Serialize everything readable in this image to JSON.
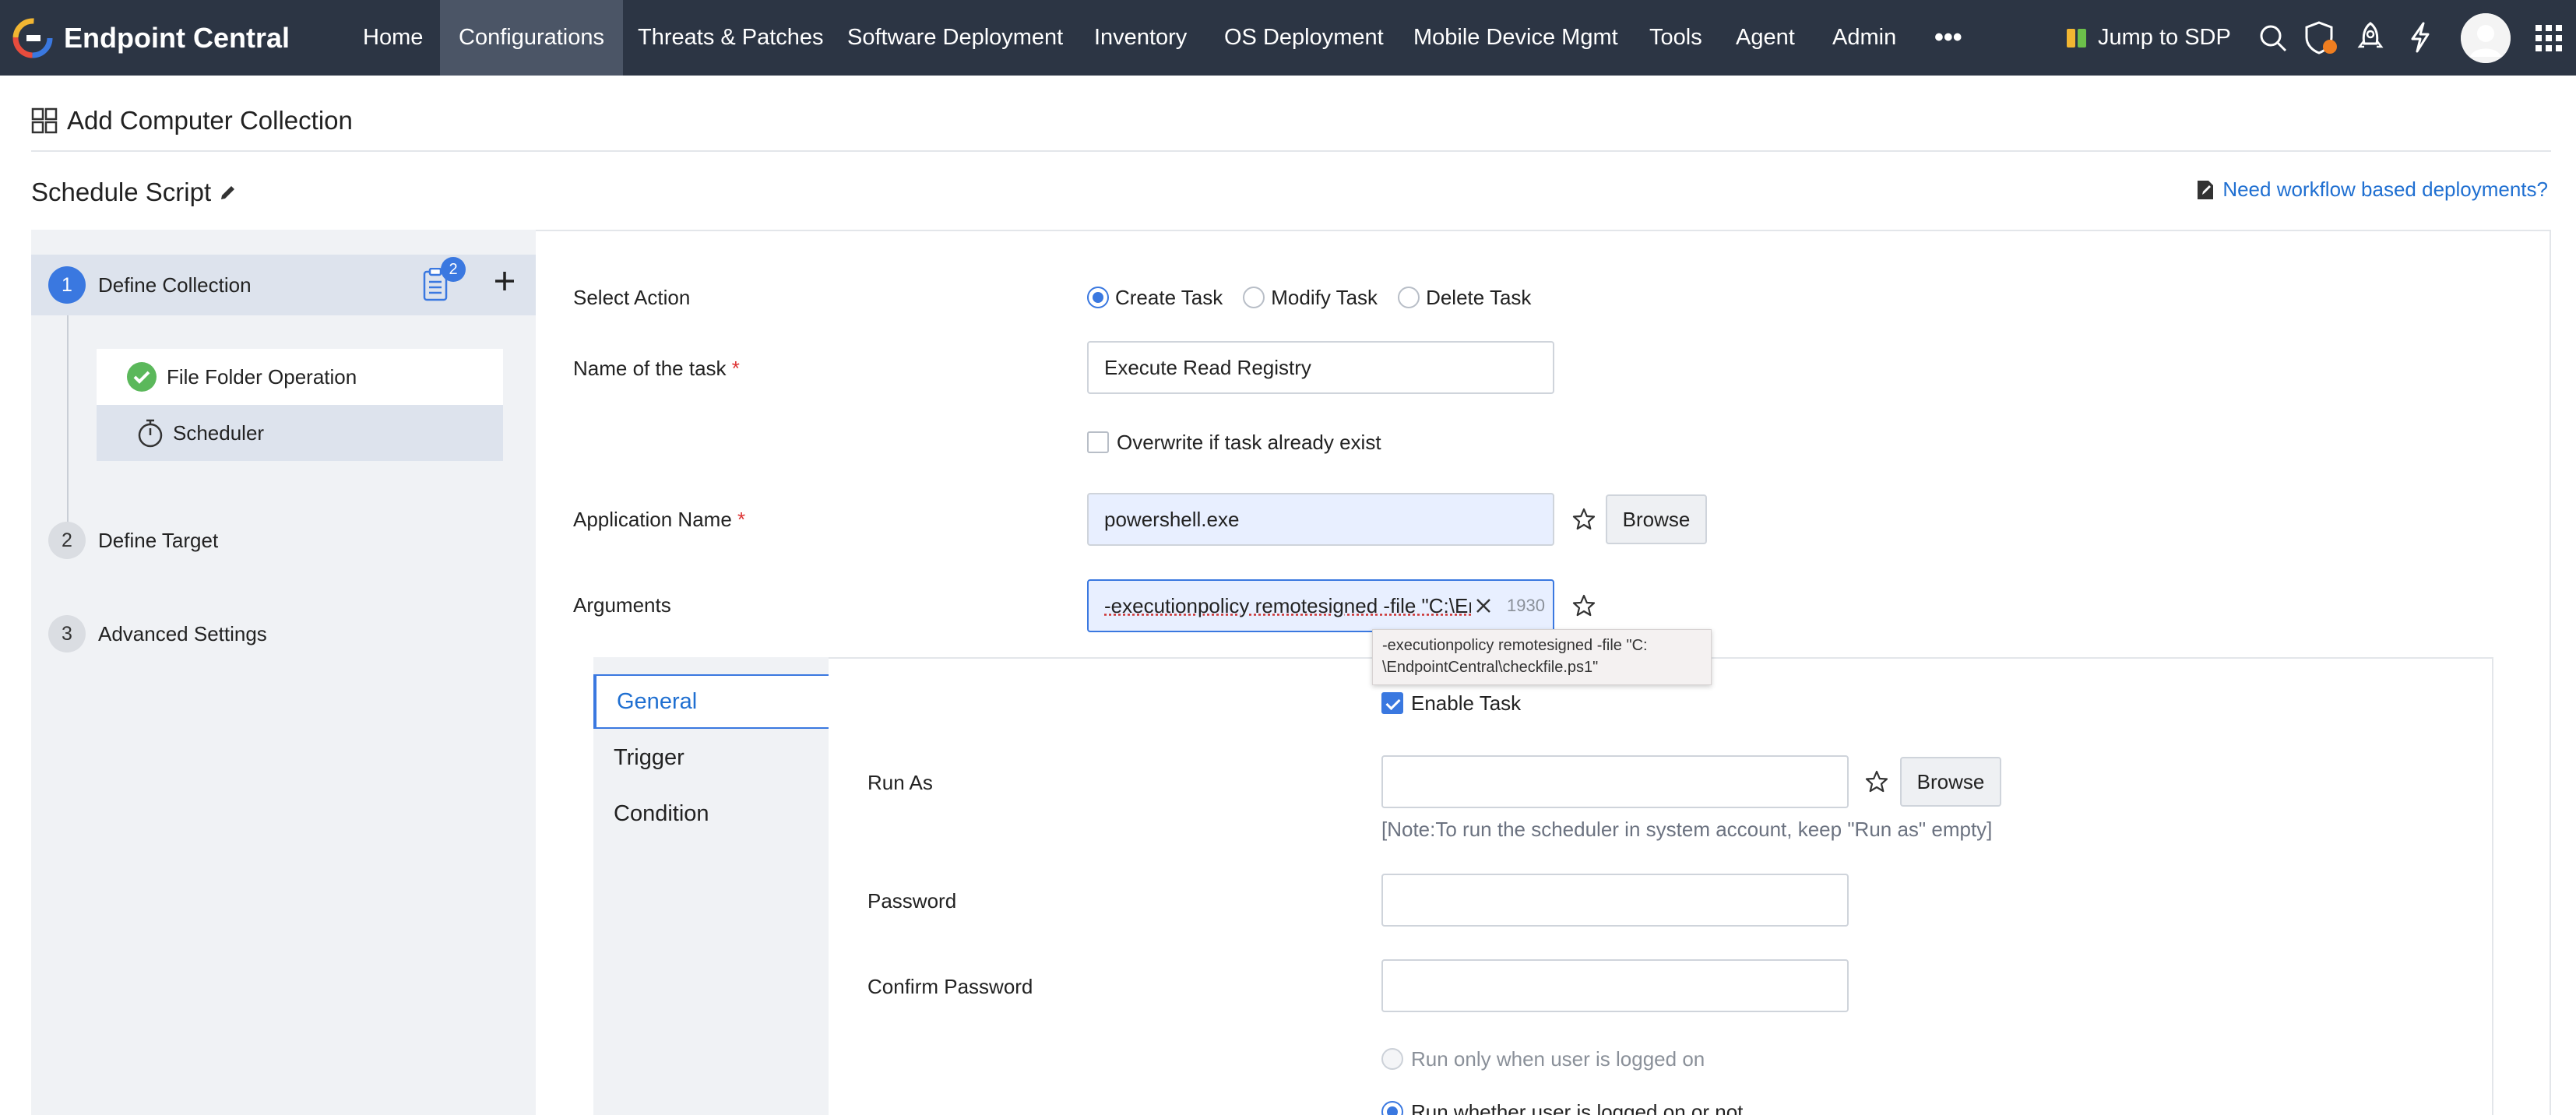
{
  "app": {
    "brand": "Endpoint Central",
    "nav": [
      {
        "label": "Home",
        "active": false
      },
      {
        "label": "Configurations",
        "active": true
      },
      {
        "label": "Threats & Patches",
        "active": false
      },
      {
        "label": "Software Deployment",
        "active": false
      },
      {
        "label": "Inventory",
        "active": false
      },
      {
        "label": "OS Deployment",
        "active": false
      },
      {
        "label": "Mobile Device Mgmt",
        "active": false
      },
      {
        "label": "Tools",
        "active": false
      },
      {
        "label": "Agent",
        "active": false
      },
      {
        "label": "Admin",
        "active": false
      }
    ],
    "more_label": "•••",
    "jump_label": "Jump to SDP",
    "right_icons": [
      "search-icon",
      "shield-alert-icon",
      "rocket-icon",
      "lightning-icon",
      "avatar",
      "apps-grid-icon"
    ]
  },
  "header": {
    "page_title": "Add Computer Collection",
    "sub_title": "Schedule Script",
    "workflow_link": "Need workflow based deployments?"
  },
  "sidebar": {
    "steps": [
      {
        "num": "1",
        "label": "Define Collection",
        "active": true
      },
      {
        "num": "2",
        "label": "Define Target",
        "active": false
      },
      {
        "num": "3",
        "label": "Advanced Settings",
        "active": false
      }
    ],
    "badge_count": "2",
    "sub_items": [
      {
        "label": "File Folder Operation",
        "icon": "check-circle-icon"
      },
      {
        "label": "Scheduler",
        "icon": "timer-icon"
      }
    ]
  },
  "form": {
    "select_action_label": "Select Action",
    "actions": [
      {
        "label": "Create Task",
        "checked": true
      },
      {
        "label": "Modify Task",
        "checked": false
      },
      {
        "label": "Delete Task",
        "checked": false
      }
    ],
    "task_name_label": "Name of the task",
    "required_mark": "*",
    "task_name_value": "Execute Read Registry",
    "overwrite_label": "Overwrite if task already exist",
    "app_name_label": "Application Name",
    "app_name_value": "powershell.exe",
    "browse_label": "Browse",
    "arguments_label": "Arguments",
    "arguments_value": "-executionpolicy remotesigned -file \"C:\\En",
    "arguments_count": "1930",
    "tooltip_line1": "-executionpolicy remotesigned -file \"C:",
    "tooltip_line2": "\\EndpointCentral\\checkfile.ps1\""
  },
  "scheduler": {
    "tabs": [
      {
        "label": "General",
        "active": true
      },
      {
        "label": "Trigger",
        "active": false
      },
      {
        "label": "Condition",
        "active": false
      }
    ],
    "enable_task_label": "Enable Task",
    "run_as_label": "Run As",
    "browse_label": "Browse",
    "note": "[Note:To run the scheduler in system account, keep \"Run as\" empty]",
    "password_label": "Password",
    "confirm_password_label": "Confirm Password",
    "run_logged_on_label": "Run only when user is logged on",
    "run_whether_label": "Run whether user is logged on or not"
  }
}
